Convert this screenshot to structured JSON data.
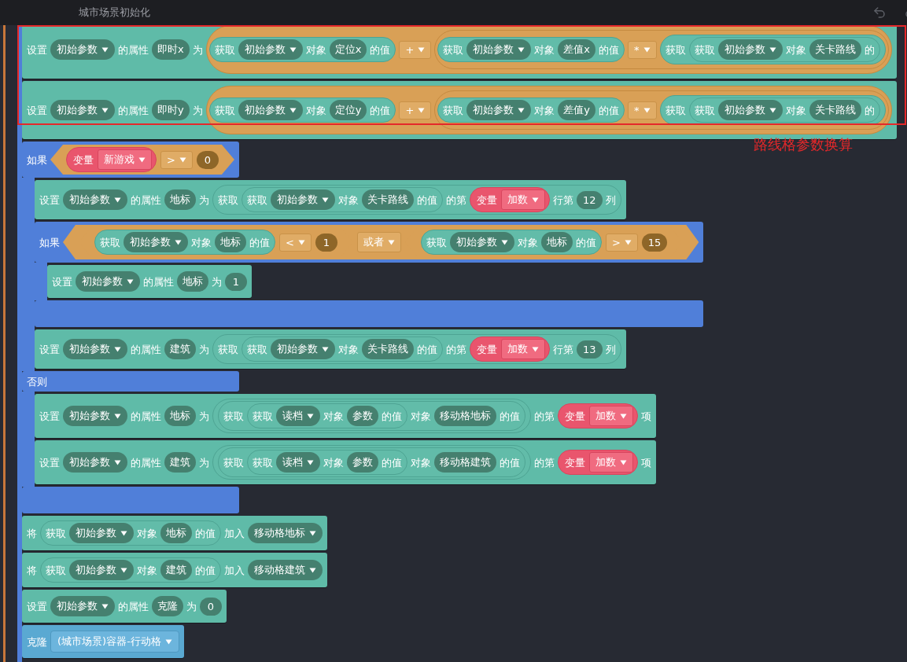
{
  "window": {
    "title": "城市场景初始化"
  },
  "annotation": {
    "text": "路线格参数换算"
  },
  "script": [
    {
      "kind": "statement",
      "items": [
        {
          "kind": "text",
          "text": "设置"
        },
        {
          "kind": "dropdown",
          "text": "初始参数"
        },
        {
          "kind": "text",
          "text": "的属性"
        },
        {
          "kind": "field",
          "text": "即时x"
        },
        {
          "kind": "text",
          "text": "为"
        },
        {
          "kind": "expression",
          "items": [
            {
              "kind": "reporter",
              "items": [
                {
                  "kind": "text",
                  "text": "获取"
                },
                {
                  "kind": "dropdown",
                  "text": "初始参数"
                },
                {
                  "kind": "text",
                  "text": "对象"
                },
                {
                  "kind": "field",
                  "text": "定位x"
                },
                {
                  "kind": "text",
                  "text": "的值"
                }
              ]
            },
            {
              "kind": "operator",
              "text": "+"
            },
            {
              "kind": "expression",
              "items": [
                {
                  "kind": "reporter",
                  "items": [
                    {
                      "kind": "text",
                      "text": "获取"
                    },
                    {
                      "kind": "dropdown",
                      "text": "初始参数"
                    },
                    {
                      "kind": "text",
                      "text": "对象"
                    },
                    {
                      "kind": "field",
                      "text": "差值x"
                    },
                    {
                      "kind": "text",
                      "text": "的值"
                    }
                  ]
                },
                {
                  "kind": "operator",
                  "text": "*"
                },
                {
                  "kind": "reporter",
                  "items": [
                    {
                      "kind": "text",
                      "text": "获取"
                    },
                    {
                      "kind": "reporter",
                      "items": [
                        {
                          "kind": "text",
                          "text": "获取"
                        },
                        {
                          "kind": "dropdown",
                          "text": "初始参数"
                        },
                        {
                          "kind": "text",
                          "text": "对象"
                        },
                        {
                          "kind": "field",
                          "text": "关卡路线"
                        },
                        {
                          "kind": "text",
                          "text": "的"
                        }
                      ]
                    }
                  ]
                }
              ]
            }
          ]
        }
      ]
    },
    {
      "kind": "statement",
      "items": [
        {
          "kind": "text",
          "text": "设置"
        },
        {
          "kind": "dropdown",
          "text": "初始参数"
        },
        {
          "kind": "text",
          "text": "的属性"
        },
        {
          "kind": "field",
          "text": "即时y"
        },
        {
          "kind": "text",
          "text": "为"
        },
        {
          "kind": "expression",
          "items": [
            {
              "kind": "reporter",
              "items": [
                {
                  "kind": "text",
                  "text": "获取"
                },
                {
                  "kind": "dropdown",
                  "text": "初始参数"
                },
                {
                  "kind": "text",
                  "text": "对象"
                },
                {
                  "kind": "field",
                  "text": "定位y"
                },
                {
                  "kind": "text",
                  "text": "的值"
                }
              ]
            },
            {
              "kind": "operator",
              "text": "+"
            },
            {
              "kind": "expression",
              "items": [
                {
                  "kind": "reporter",
                  "items": [
                    {
                      "kind": "text",
                      "text": "获取"
                    },
                    {
                      "kind": "dropdown",
                      "text": "初始参数"
                    },
                    {
                      "kind": "text",
                      "text": "对象"
                    },
                    {
                      "kind": "field",
                      "text": "差值y"
                    },
                    {
                      "kind": "text",
                      "text": "的值"
                    }
                  ]
                },
                {
                  "kind": "operator",
                  "text": "*"
                },
                {
                  "kind": "reporter",
                  "items": [
                    {
                      "kind": "text",
                      "text": "获取"
                    },
                    {
                      "kind": "reporter",
                      "items": [
                        {
                          "kind": "text",
                          "text": "获取"
                        },
                        {
                          "kind": "dropdown",
                          "text": "初始参数"
                        },
                        {
                          "kind": "text",
                          "text": "对象"
                        },
                        {
                          "kind": "field",
                          "text": "关卡路线"
                        },
                        {
                          "kind": "text",
                          "text": "的"
                        }
                      ]
                    }
                  ]
                }
              ]
            }
          ]
        }
      ]
    },
    {
      "kind": "if",
      "label": "如果",
      "condition": [
        {
          "kind": "variable",
          "label": "变量",
          "name": "新游戏"
        },
        {
          "kind": "operator",
          "text": ">"
        },
        {
          "kind": "number",
          "text": "0"
        }
      ],
      "body": [
        {
          "kind": "statement",
          "items": [
            {
              "kind": "text",
              "text": "设置"
            },
            {
              "kind": "dropdown",
              "text": "初始参数"
            },
            {
              "kind": "text",
              "text": "的属性"
            },
            {
              "kind": "field",
              "text": "地标"
            },
            {
              "kind": "text",
              "text": "为"
            },
            {
              "kind": "reporter",
              "items": [
                {
                  "kind": "text",
                  "text": "获取"
                },
                {
                  "kind": "reporter",
                  "items": [
                    {
                      "kind": "text",
                      "text": "获取"
                    },
                    {
                      "kind": "dropdown",
                      "text": "初始参数"
                    },
                    {
                      "kind": "text",
                      "text": "对象"
                    },
                    {
                      "kind": "field",
                      "text": "关卡路线"
                    },
                    {
                      "kind": "text",
                      "text": "的值"
                    }
                  ]
                },
                {
                  "kind": "text",
                  "text": "的第"
                },
                {
                  "kind": "variable",
                  "label": "变量",
                  "name": "加数"
                },
                {
                  "kind": "text",
                  "text": "行第"
                },
                {
                  "kind": "number",
                  "text": "12"
                },
                {
                  "kind": "text",
                  "text": "列"
                }
              ]
            }
          ]
        },
        {
          "kind": "if",
          "label": "如果",
          "condition": [
            {
              "kind": "condition",
              "items": [
                {
                  "kind": "reporter",
                  "items": [
                    {
                      "kind": "text",
                      "text": "获取"
                    },
                    {
                      "kind": "dropdown",
                      "text": "初始参数"
                    },
                    {
                      "kind": "text",
                      "text": "对象"
                    },
                    {
                      "kind": "field",
                      "text": "地标"
                    },
                    {
                      "kind": "text",
                      "text": "的值"
                    }
                  ]
                },
                {
                  "kind": "operator",
                  "text": "<"
                },
                {
                  "kind": "number",
                  "text": "1"
                }
              ]
            },
            {
              "kind": "operator",
              "text": "或者"
            },
            {
              "kind": "condition",
              "items": [
                {
                  "kind": "reporter",
                  "items": [
                    {
                      "kind": "text",
                      "text": "获取"
                    },
                    {
                      "kind": "dropdown",
                      "text": "初始参数"
                    },
                    {
                      "kind": "text",
                      "text": "对象"
                    },
                    {
                      "kind": "field",
                      "text": "地标"
                    },
                    {
                      "kind": "text",
                      "text": "的值"
                    }
                  ]
                },
                {
                  "kind": "operator",
                  "text": ">"
                },
                {
                  "kind": "number",
                  "text": "15"
                }
              ]
            }
          ],
          "body": [
            {
              "kind": "statement",
              "items": [
                {
                  "kind": "text",
                  "text": "设置"
                },
                {
                  "kind": "dropdown",
                  "text": "初始参数"
                },
                {
                  "kind": "text",
                  "text": "的属性"
                },
                {
                  "kind": "field",
                  "text": "地标"
                },
                {
                  "kind": "text",
                  "text": "为"
                },
                {
                  "kind": "number",
                  "text": "1"
                }
              ]
            }
          ]
        },
        {
          "kind": "statement",
          "items": [
            {
              "kind": "text",
              "text": "设置"
            },
            {
              "kind": "dropdown",
              "text": "初始参数"
            },
            {
              "kind": "text",
              "text": "的属性"
            },
            {
              "kind": "field",
              "text": "建筑"
            },
            {
              "kind": "text",
              "text": "为"
            },
            {
              "kind": "reporter",
              "items": [
                {
                  "kind": "text",
                  "text": "获取"
                },
                {
                  "kind": "reporter",
                  "items": [
                    {
                      "kind": "text",
                      "text": "获取"
                    },
                    {
                      "kind": "dropdown",
                      "text": "初始参数"
                    },
                    {
                      "kind": "text",
                      "text": "对象"
                    },
                    {
                      "kind": "field",
                      "text": "关卡路线"
                    },
                    {
                      "kind": "text",
                      "text": "的值"
                    }
                  ]
                },
                {
                  "kind": "text",
                  "text": "的第"
                },
                {
                  "kind": "variable",
                  "label": "变量",
                  "name": "加数"
                },
                {
                  "kind": "text",
                  "text": "行第"
                },
                {
                  "kind": "number",
                  "text": "13"
                },
                {
                  "kind": "text",
                  "text": "列"
                }
              ]
            }
          ]
        }
      ],
      "else_label": "否则",
      "else_body": [
        {
          "kind": "statement",
          "items": [
            {
              "kind": "text",
              "text": "设置"
            },
            {
              "kind": "dropdown",
              "text": "初始参数"
            },
            {
              "kind": "text",
              "text": "的属性"
            },
            {
              "kind": "field",
              "text": "地标"
            },
            {
              "kind": "text",
              "text": "为"
            },
            {
              "kind": "reporter",
              "items": [
                {
                  "kind": "reporter",
                  "items": [
                    {
                      "kind": "text",
                      "text": "获取"
                    },
                    {
                      "kind": "reporter",
                      "items": [
                        {
                          "kind": "text",
                          "text": "获取"
                        },
                        {
                          "kind": "dropdown",
                          "text": "读档"
                        },
                        {
                          "kind": "text",
                          "text": "对象"
                        },
                        {
                          "kind": "field",
                          "text": "参数"
                        },
                        {
                          "kind": "text",
                          "text": "的值"
                        }
                      ]
                    },
                    {
                      "kind": "text",
                      "text": "对象"
                    },
                    {
                      "kind": "field",
                      "text": "移动格地标"
                    },
                    {
                      "kind": "text",
                      "text": "的值"
                    }
                  ]
                }
              ]
            },
            {
              "kind": "text",
              "text": "的第"
            },
            {
              "kind": "variable",
              "label": "变量",
              "name": "加数"
            },
            {
              "kind": "text",
              "text": "项"
            }
          ]
        },
        {
          "kind": "statement",
          "items": [
            {
              "kind": "text",
              "text": "设置"
            },
            {
              "kind": "dropdown",
              "text": "初始参数"
            },
            {
              "kind": "text",
              "text": "的属性"
            },
            {
              "kind": "field",
              "text": "建筑"
            },
            {
              "kind": "text",
              "text": "为"
            },
            {
              "kind": "reporter",
              "items": [
                {
                  "kind": "reporter",
                  "items": [
                    {
                      "kind": "text",
                      "text": "获取"
                    },
                    {
                      "kind": "reporter",
                      "items": [
                        {
                          "kind": "text",
                          "text": "获取"
                        },
                        {
                          "kind": "dropdown",
                          "text": "读档"
                        },
                        {
                          "kind": "text",
                          "text": "对象"
                        },
                        {
                          "kind": "field",
                          "text": "参数"
                        },
                        {
                          "kind": "text",
                          "text": "的值"
                        }
                      ]
                    },
                    {
                      "kind": "text",
                      "text": "对象"
                    },
                    {
                      "kind": "field",
                      "text": "移动格建筑"
                    },
                    {
                      "kind": "text",
                      "text": "的值"
                    }
                  ]
                }
              ]
            },
            {
              "kind": "text",
              "text": "的第"
            },
            {
              "kind": "variable",
              "label": "变量",
              "name": "加数"
            },
            {
              "kind": "text",
              "text": "项"
            }
          ]
        }
      ]
    },
    {
      "kind": "statement",
      "items": [
        {
          "kind": "text",
          "text": "将"
        },
        {
          "kind": "reporter",
          "items": [
            {
              "kind": "text",
              "text": "获取"
            },
            {
              "kind": "dropdown",
              "text": "初始参数"
            },
            {
              "kind": "text",
              "text": "对象"
            },
            {
              "kind": "field",
              "text": "地标"
            },
            {
              "kind": "text",
              "text": "的值"
            }
          ]
        },
        {
          "kind": "text",
          "text": "加入"
        },
        {
          "kind": "dropdown",
          "text": "移动格地标"
        }
      ]
    },
    {
      "kind": "statement",
      "items": [
        {
          "kind": "text",
          "text": "将"
        },
        {
          "kind": "reporter",
          "items": [
            {
              "kind": "text",
              "text": "获取"
            },
            {
              "kind": "dropdown",
              "text": "初始参数"
            },
            {
              "kind": "text",
              "text": "对象"
            },
            {
              "kind": "field",
              "text": "建筑"
            },
            {
              "kind": "text",
              "text": "的值"
            }
          ]
        },
        {
          "kind": "text",
          "text": "加入"
        },
        {
          "kind": "dropdown",
          "text": "移动格建筑"
        }
      ]
    },
    {
      "kind": "statement",
      "items": [
        {
          "kind": "text",
          "text": "设置"
        },
        {
          "kind": "dropdown",
          "text": "初始参数"
        },
        {
          "kind": "text",
          "text": "的属性"
        },
        {
          "kind": "field",
          "text": "克隆"
        },
        {
          "kind": "text",
          "text": "为"
        },
        {
          "kind": "number",
          "text": "0"
        }
      ]
    },
    {
      "kind": "clone",
      "items": [
        {
          "kind": "text",
          "text": "克隆"
        },
        {
          "kind": "dropdown",
          "text": "(城市场景)容器-行动格"
        }
      ]
    }
  ]
}
